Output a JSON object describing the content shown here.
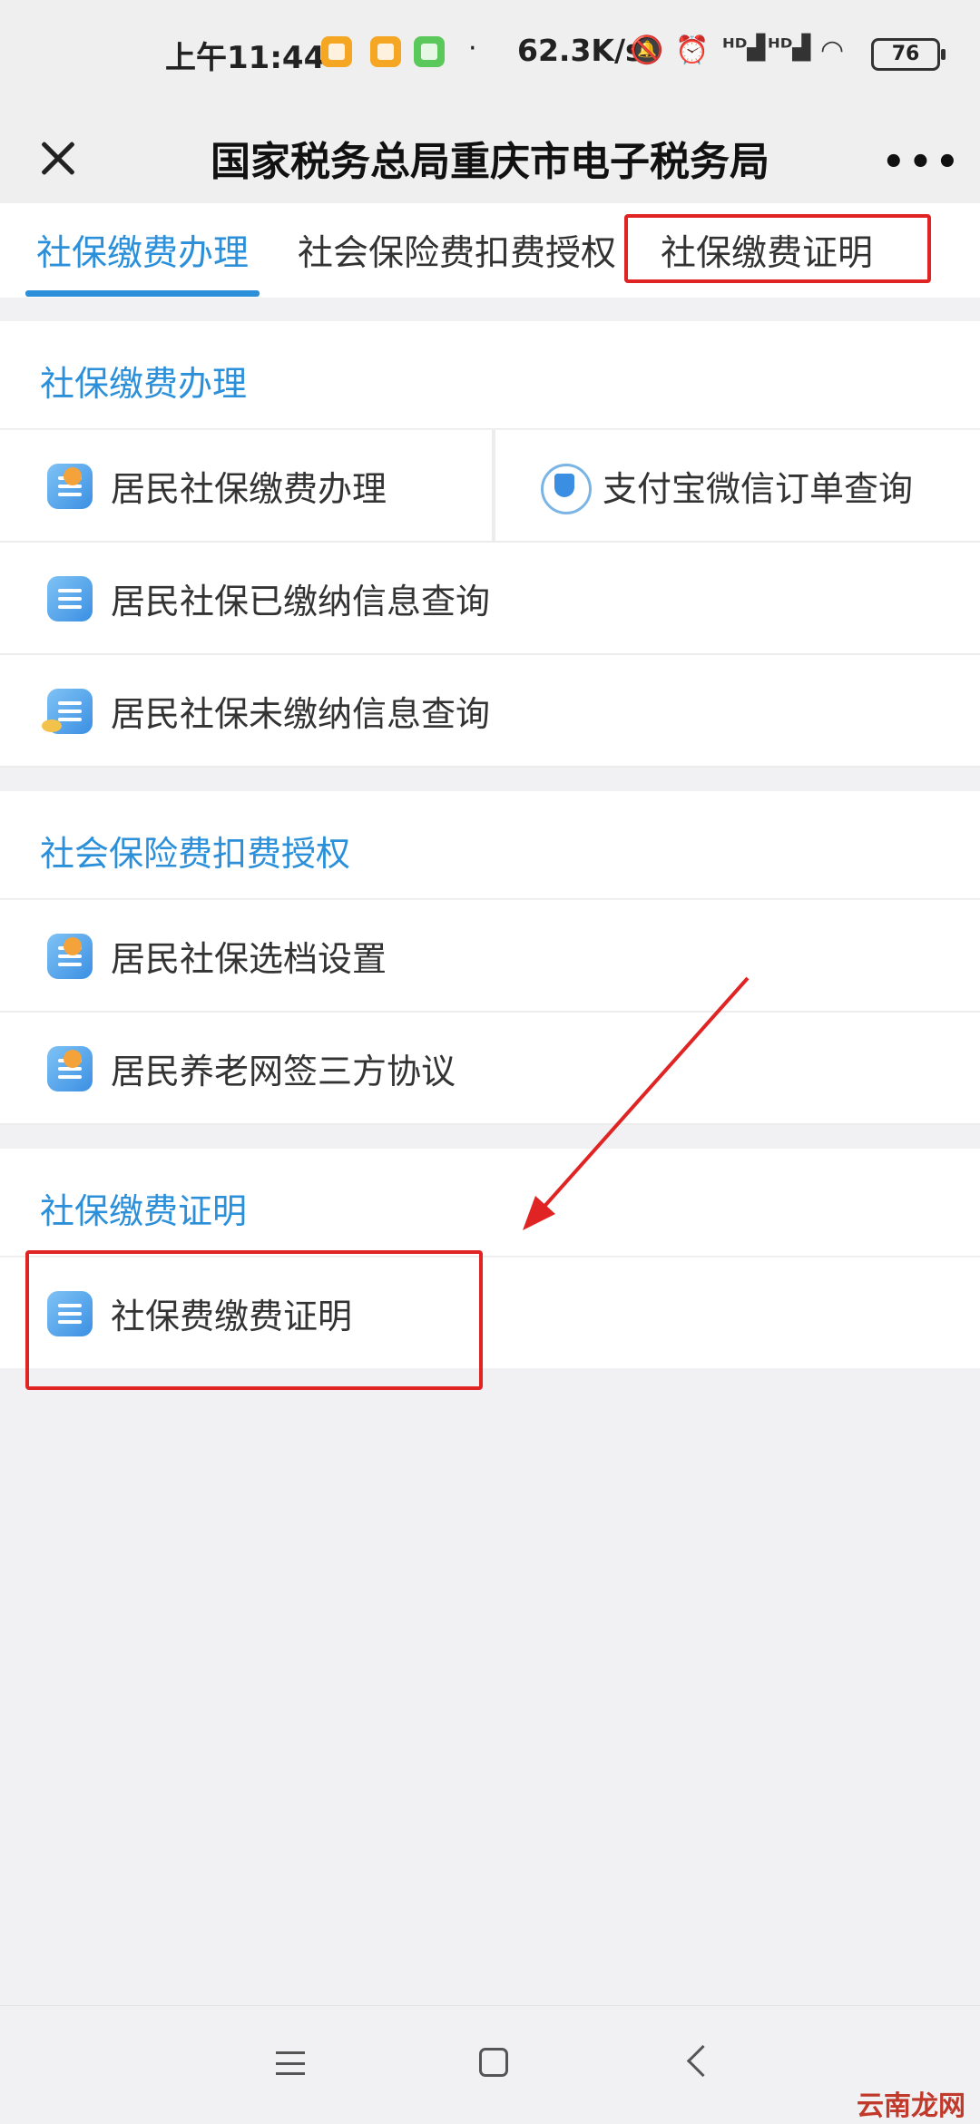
{
  "status_bar": {
    "time": "上午11:44",
    "separator": "·",
    "net_speed": "62.3K/s",
    "battery": "76",
    "icons": [
      "app-notification-icon",
      "app-notification-icon",
      "app-notification-icon",
      "mute-bell-icon",
      "alarm-icon",
      "hd-signal-icon",
      "hd-signal-icon",
      "wifi-icon",
      "battery-icon"
    ]
  },
  "titlebar": {
    "title": "国家税务总局重庆市电子税务局",
    "close": "✕",
    "more": "•••"
  },
  "tabs": [
    {
      "label": "社保缴费办理",
      "active": true
    },
    {
      "label": "社会保险费扣费授权",
      "active": false
    },
    {
      "label": "社保缴费证明",
      "active": false,
      "highlighted": true
    }
  ],
  "sections": [
    {
      "title": "社保缴费办理",
      "items": [
        {
          "label": "居民社保缴费办理",
          "icon": "user-yuan-icon"
        },
        {
          "label": "支付宝微信订单查询",
          "icon": "shield-yuan-icon"
        },
        {
          "label": "居民社保已缴纳信息查询",
          "icon": "document-list-icon"
        },
        {
          "label": "居民社保未缴纳信息查询",
          "icon": "wallet-coin-icon"
        }
      ]
    },
    {
      "title": "社会保险费扣费授权",
      "items": [
        {
          "label": "居民社保选档设置",
          "icon": "hand-gear-icon"
        },
        {
          "label": "居民养老网签三方协议",
          "icon": "user-contract-icon"
        }
      ]
    },
    {
      "title": "社保缴费证明",
      "items": [
        {
          "label": "社保费缴费证明",
          "icon": "certificate-icon",
          "highlighted": true
        }
      ]
    }
  ],
  "bottom_nav": [
    "menu-icon",
    "home-icon",
    "back-icon"
  ],
  "watermark": "云南龙网",
  "colors": {
    "accent": "#2b90d9",
    "annotation": "#e02424",
    "background": "#f1f1f3"
  }
}
